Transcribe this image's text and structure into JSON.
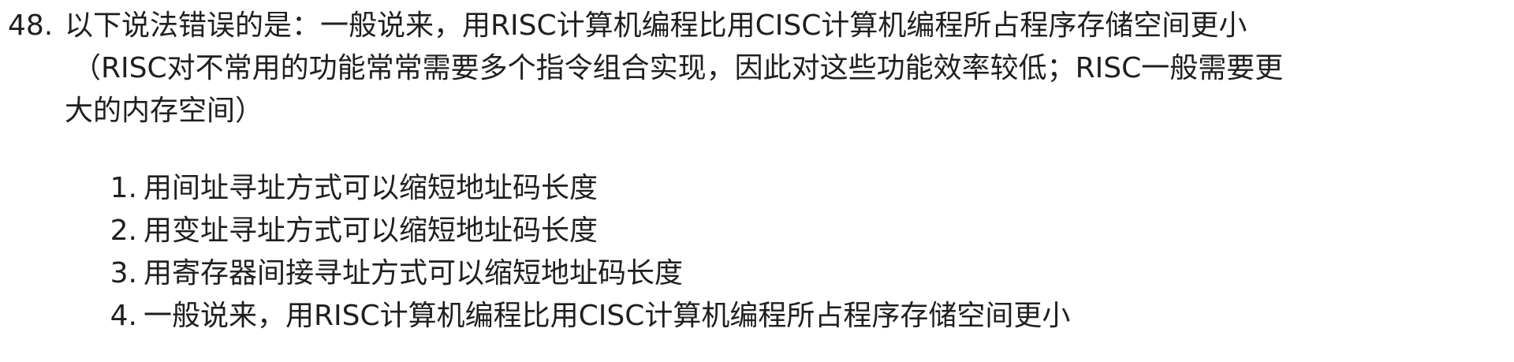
{
  "question": {
    "number": "48.",
    "stem": "以下说法错误的是：一般说来，用RISC计算机编程比用CISC计算机编程所占程序存储空间更小",
    "explanation_line1": "（RISC对不常用的功能常常需要多个指令组合实现，因此对这些功能效率较低；RISC一般需要更",
    "explanation_line2": "大的内存空间）"
  },
  "options": [
    {
      "num": "1.",
      "text": "用间址寻址方式可以缩短地址码长度"
    },
    {
      "num": "2.",
      "text": "用变址寻址方式可以缩短地址码长度"
    },
    {
      "num": "3.",
      "text": "用寄存器间接寻址方式可以缩短地址码长度"
    },
    {
      "num": "4.",
      "text": "一般说来，用RISC计算机编程比用CISC计算机编程所占程序存储空间更小"
    }
  ]
}
